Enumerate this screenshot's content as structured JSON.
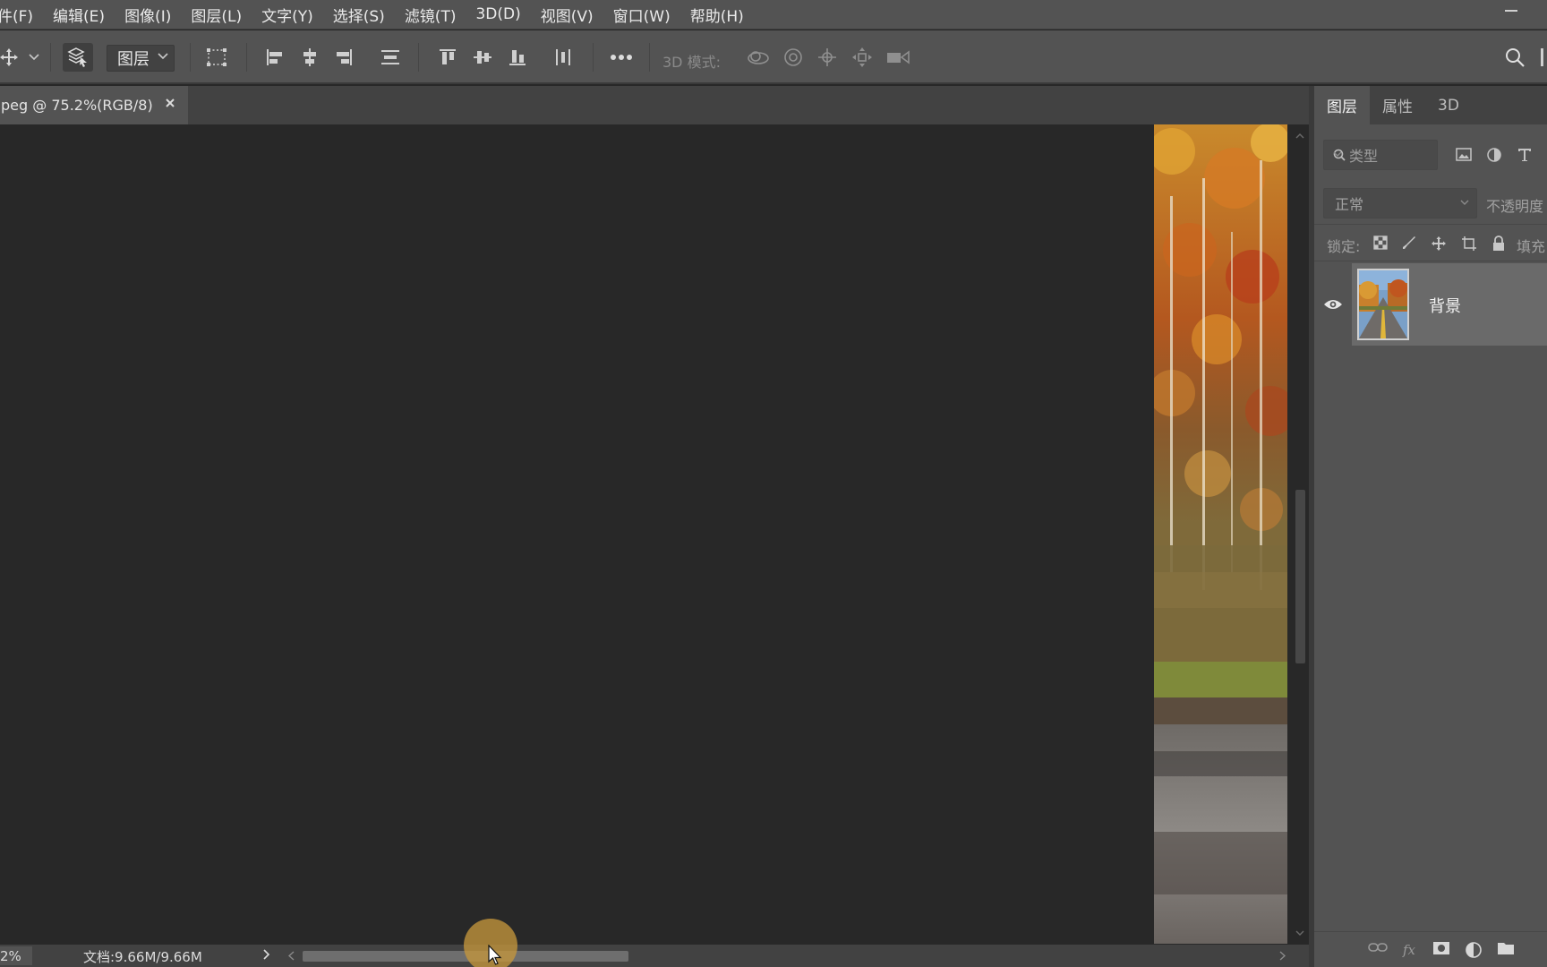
{
  "menubar": {
    "items": [
      "件(F)",
      "编辑(E)",
      "图像(I)",
      "图层(L)",
      "文字(Y)",
      "选择(S)",
      "滤镜(T)",
      "3D(D)",
      "视图(V)",
      "窗口(W)",
      "帮助(H)"
    ]
  },
  "optionsbar": {
    "layer_select": "图层",
    "mode_label": "3D 模式:"
  },
  "document": {
    "tab_title": "peg @ 75.2%(RGB/8)",
    "close_glyph": "×"
  },
  "statusbar": {
    "zoom": "2%",
    "doc_info": "文档:9.66M/9.66M"
  },
  "layers_panel": {
    "tabs": [
      "图层",
      "属性",
      "3D"
    ],
    "filter_placeholder": "类型",
    "blend_mode": "正常",
    "opacity_label": "不透明度",
    "lock_label": "锁定:",
    "fill_label": "填充",
    "layers": [
      {
        "name": "背景",
        "visible": true
      }
    ]
  },
  "colors": {
    "ui_panel": "#535353",
    "ui_dark": "#424242",
    "canvas_bg": "#282828",
    "selected_layer": "#6a6a6a"
  }
}
